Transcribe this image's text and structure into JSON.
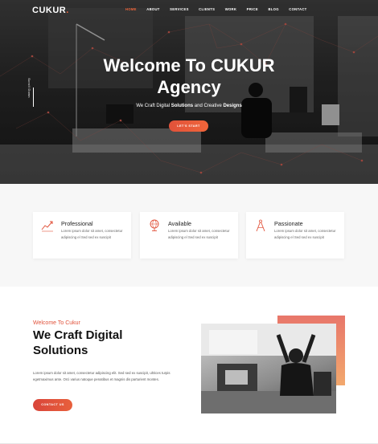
{
  "brand": {
    "name": "CUKUR",
    "dot": "."
  },
  "nav": {
    "items": [
      {
        "label": "HOME",
        "active": true
      },
      {
        "label": "ABOUT",
        "active": false
      },
      {
        "label": "SERVICES",
        "active": false
      },
      {
        "label": "CLIENTS",
        "active": false
      },
      {
        "label": "WORK",
        "active": false
      },
      {
        "label": "PRICE",
        "active": false
      },
      {
        "label": "BLOG",
        "active": false
      },
      {
        "label": "CONTACT",
        "active": false
      }
    ]
  },
  "hero": {
    "scroll_label": "Scroll Down",
    "title_prefix": "Welcome To ",
    "title_brand": "CUKUR",
    "title_line2": "Agency",
    "subtitle_1": "We Craft Digital ",
    "subtitle_2": "Solutions",
    "subtitle_3": " and Creative ",
    "subtitle_4": "Designs",
    "cta_label": "LET'S START"
  },
  "features": [
    {
      "title": "Professional",
      "text": "Lorem ipsum dolor sit amet, consectetur adipiscing el Sed sed ex suscipit",
      "icon": "chart-line-icon"
    },
    {
      "title": "Available",
      "text": "Lorem ipsum dolor sit amet, consectetur adipiscing el Sed sed ex suscipit",
      "icon": "globe-icon"
    },
    {
      "title": "Passionate",
      "text": "Lorem ipsum dolor sit amet, consectetur adipiscing el Sed sed ex suscipit",
      "icon": "compass-icon"
    }
  ],
  "about": {
    "kicker": "Welcome To Cukur",
    "title_line1": "We Craft Digital",
    "title_line2": "Solutions",
    "text": "Lorem ipsum dolor sit amet, consectetur adipiscing elit. Sed sed ex suscipit, ultrices turpis egetmaximus ante. Orci varius natoque penatibus et magnis dis parturient montes.",
    "cta_label": "CONTACT US"
  },
  "colors": {
    "accent": "#f0653a",
    "accent_dark": "#d9453a"
  }
}
